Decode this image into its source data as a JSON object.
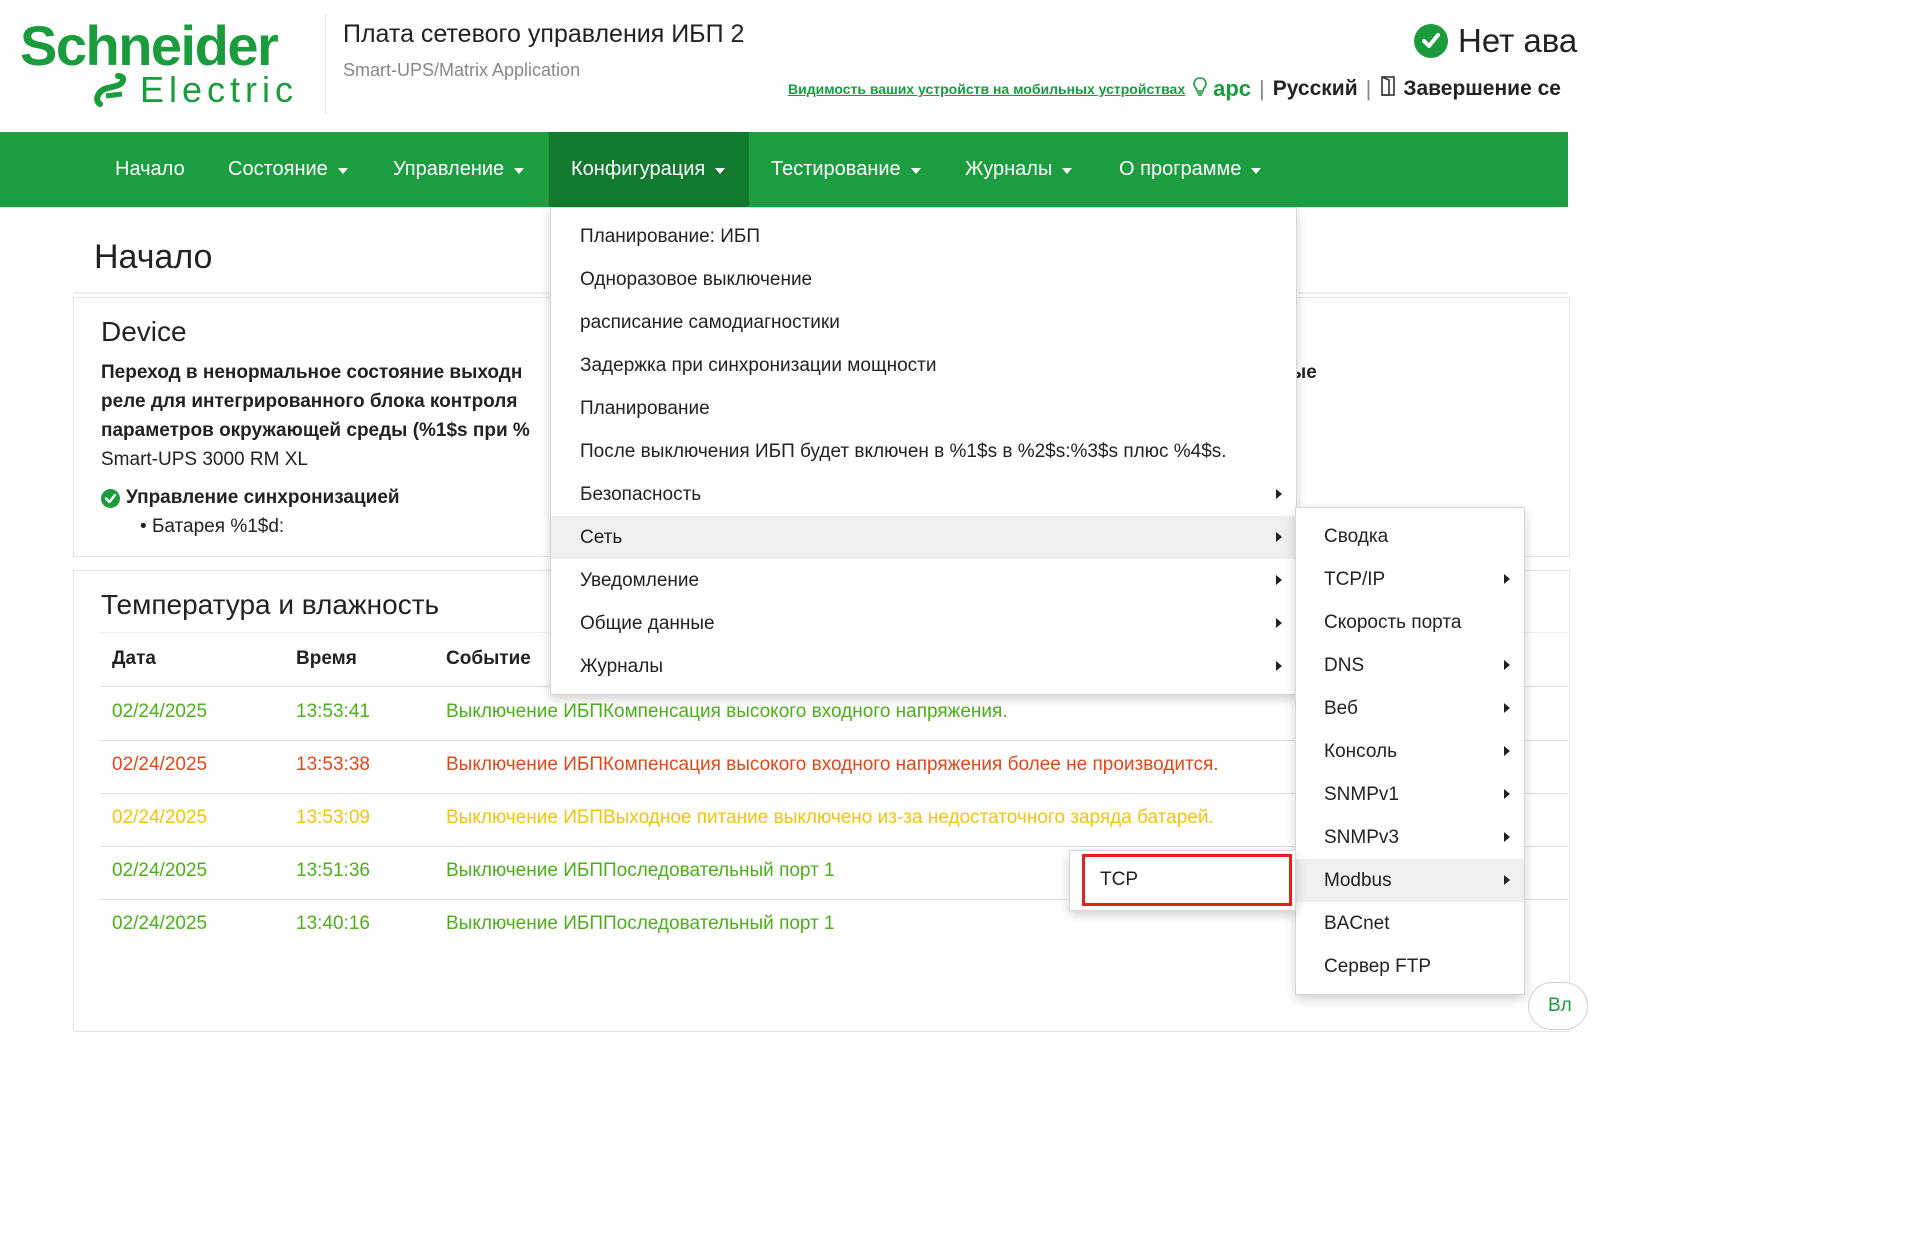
{
  "header": {
    "logo_line1": "Schneider",
    "logo_line2": "Electric",
    "title": "Плата сетевого управления ИБП 2",
    "subtitle": "Smart-UPS/Matrix Application",
    "alarm_status": "Нет ава",
    "mobile_link": "Видимость ваших устройств на мобильных устройствах",
    "apc_label": "apc",
    "language": "Русский",
    "logout": "Завершение се"
  },
  "nav": {
    "items": [
      {
        "label": "Начало"
      },
      {
        "label": "Состояние"
      },
      {
        "label": "Управление"
      },
      {
        "label": "Конфигурация",
        "active": true
      },
      {
        "label": "Тестирование"
      },
      {
        "label": "Журналы"
      },
      {
        "label": "О программе"
      }
    ]
  },
  "page": {
    "title": "Начало"
  },
  "device": {
    "heading": "Device",
    "bold_line1": "Переход в ненормальное состояние выходн",
    "bold_line1_tail": "ые",
    "bold_line2": "реле для интегрированного блока контроля",
    "bold_line3": "параметров окружающей среды (%1$s при %",
    "model": "Smart-UPS 3000 RM XL",
    "sync_label": "Управление синхронизацией",
    "battery": "Батарея %1$d:"
  },
  "temperature": {
    "heading": "Температура и влажность",
    "columns": [
      "Дата",
      "Время",
      "Событие"
    ],
    "rows": [
      {
        "date": "02/24/2025",
        "time": "13:53:41",
        "event": "Выключение ИБПКомпенсация высокого входного напряжения.",
        "color": "#4caf1a"
      },
      {
        "date": "02/24/2025",
        "time": "13:53:38",
        "event": "Выключение ИБПКомпенсация высокого входного напряжения более не производится.",
        "color": "#e0481c"
      },
      {
        "date": "02/24/2025",
        "time": "13:53:09",
        "event": "Выключение ИБПВыходное питание выключено из-за недостаточного заряда батарей.",
        "color": "#f2c40c"
      },
      {
        "date": "02/24/2025",
        "time": "13:51:36",
        "event": "Выключение ИБППоследовательный порт 1",
        "color": "#4caf1a"
      },
      {
        "date": "02/24/2025",
        "time": "13:40:16",
        "event": "Выключение ИБППоследовательный порт 1",
        "color": "#4caf1a"
      }
    ]
  },
  "config_menu": {
    "items": [
      {
        "label": "Планирование: ИБП",
        "submenu": false
      },
      {
        "label": "Одноразовое выключение",
        "submenu": false
      },
      {
        "label": "расписание самодиагностики",
        "submenu": false
      },
      {
        "label": "Задержка при синхронизации мощности",
        "submenu": false
      },
      {
        "label": "Планирование",
        "submenu": false
      },
      {
        "label": "После выключения ИБП будет включен в %1$s в %2$s:%3$s плюс %4$s.",
        "submenu": false
      },
      {
        "label": "Безопасность",
        "submenu": true
      },
      {
        "label": "Сеть",
        "submenu": true,
        "highlighted": true
      },
      {
        "label": "Уведомление",
        "submenu": true
      },
      {
        "label": "Общие данные",
        "submenu": true
      },
      {
        "label": "Журналы",
        "submenu": true
      }
    ]
  },
  "network_menu": {
    "items": [
      {
        "label": "Сводка",
        "submenu": false
      },
      {
        "label": "TCP/IP",
        "submenu": true
      },
      {
        "label": "Скорость порта",
        "submenu": false
      },
      {
        "label": "DNS",
        "submenu": true
      },
      {
        "label": "Веб",
        "submenu": true
      },
      {
        "label": "Консоль",
        "submenu": true
      },
      {
        "label": "SNMPv1",
        "submenu": true
      },
      {
        "label": "SNMPv3",
        "submenu": true
      },
      {
        "label": "Modbus",
        "submenu": true,
        "highlighted": true
      },
      {
        "label": "BACnet",
        "submenu": false
      },
      {
        "label": "Сервер FTP",
        "submenu": false
      }
    ]
  },
  "modbus_menu": {
    "items": [
      {
        "label": "TCP"
      }
    ]
  },
  "corner_button": "Вл",
  "colors": {
    "brand_green": "#1a9b3c",
    "nav_green": "#1c9d3f",
    "nav_active": "#117a2e",
    "highlight_box": "#e0231c"
  }
}
